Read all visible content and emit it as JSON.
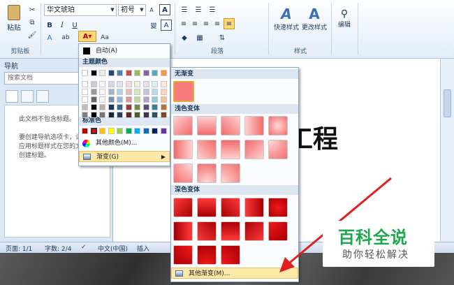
{
  "ribbon": {
    "paste_label": "粘贴",
    "clipboard_group": "剪贴板",
    "font_name": "华文琥珀",
    "font_size": "初号",
    "paragraph_group": "段落",
    "styles_group": "样式",
    "quick_styles": "快速样式",
    "change_styles": "更改样式",
    "editing": "编辑"
  },
  "nav": {
    "title": "导航",
    "search_placeholder": "搜索文档",
    "empty_msg": "此文档不包含标题。",
    "hint_line1": "要创建导航选项卡，请",
    "hint_line2": "应用标题样式在您的文",
    "hint_line3": "创建标题。"
  },
  "doc": {
    "text": "工程"
  },
  "status": {
    "page": "页面: 1/1",
    "words": "字数: 2/4",
    "language": "中文(中国)",
    "insert": "插入"
  },
  "colorMenu": {
    "auto": "自动(A)",
    "theme_colors": "主题颜色",
    "standard_colors": "标准色",
    "more_colors": "其他颜色(M)...",
    "gradient": "渐变(G)",
    "theme_row": [
      "#ffffff",
      "#000000",
      "#eeece1",
      "#1f497d",
      "#4f81bd",
      "#c0504d",
      "#9bbb59",
      "#8064a2",
      "#4bacc6",
      "#f79646"
    ],
    "standard_row": [
      "#c00000",
      "#ff0000",
      "#ffc000",
      "#ffff00",
      "#92d050",
      "#00b050",
      "#00b0f0",
      "#0070c0",
      "#002060",
      "#7030a0"
    ]
  },
  "gradMenu": {
    "no_gradient": "无渐变",
    "light_variants": "浅色变体",
    "dark_variants": "深色变体",
    "more_gradients": "其他渐变(M)..."
  },
  "watermark": {
    "title": "百科全说",
    "subtitle": "助你轻松解决"
  }
}
